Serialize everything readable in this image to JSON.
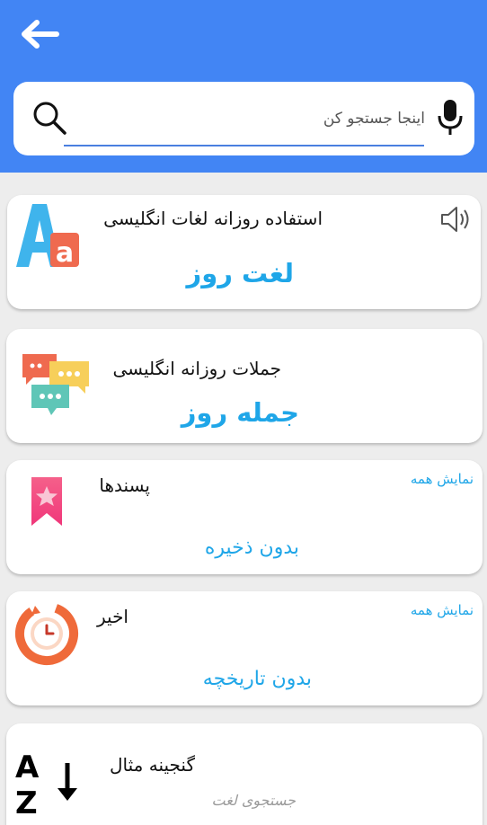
{
  "header": {
    "background": "#4285f4",
    "back_icon": "arrow-left-icon"
  },
  "search": {
    "placeholder": "اینجا جستجو کن",
    "search_icon": "search-icon",
    "mic_icon": "microphone-icon"
  },
  "cards": {
    "word_of_day": {
      "title": "استفاده روزانه لغات انگلیسی",
      "big_label": "لغت روز",
      "icon": "letters-aa-icon",
      "speaker_icon": "speaker-icon"
    },
    "sentence_of_day": {
      "title": "جملات روزانه انگلیسی",
      "big_label": "جمله روز",
      "icon": "chat-bubbles-icon"
    },
    "favorites": {
      "title": "پسندها",
      "show_all": "نمایش همه",
      "empty_text": "بدون ذخیره",
      "icon": "bookmark-star-icon"
    },
    "recent": {
      "title": "اخیر",
      "show_all": "نمایش همه",
      "empty_text": "بدون تاریخچه",
      "icon": "history-clock-icon"
    },
    "examples": {
      "title": "گنجینه مثال",
      "search_link": "جستجوی لغت",
      "icon": "az-sort-icon"
    }
  },
  "colors": {
    "accent": "#1fa6e8",
    "background": "#ededed"
  }
}
